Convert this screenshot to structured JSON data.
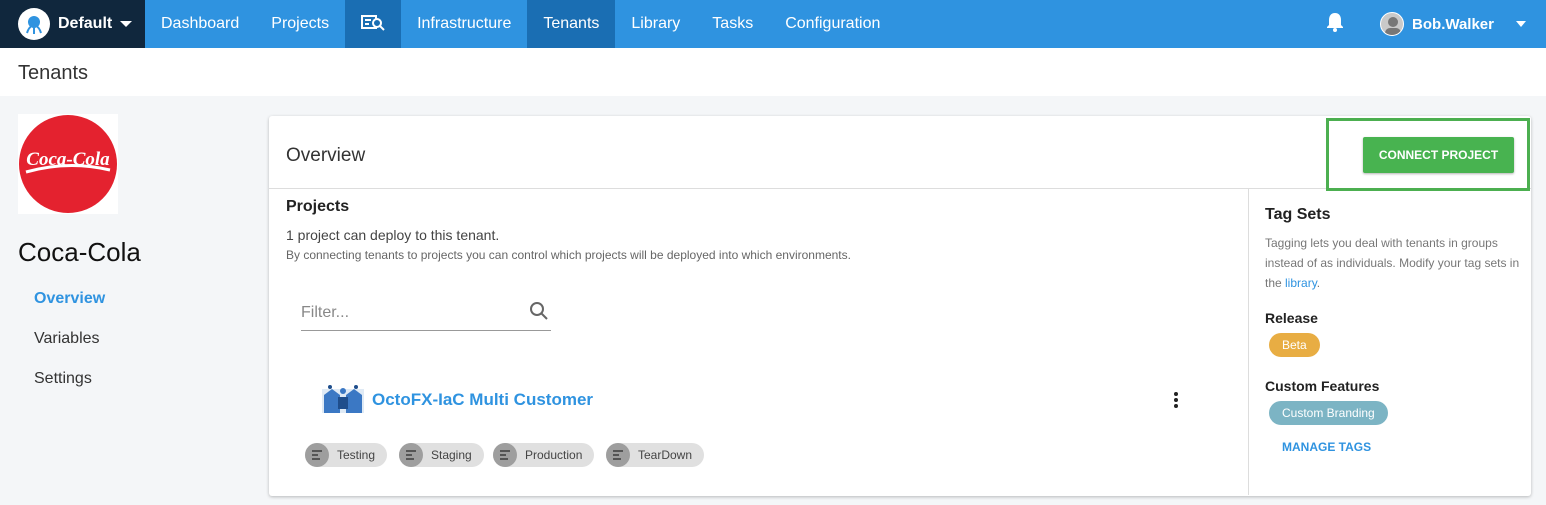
{
  "nav": {
    "space": "Default",
    "items": [
      {
        "label": "Dashboard"
      },
      {
        "label": "Projects"
      },
      {
        "label": "Infrastructure"
      },
      {
        "label": "Tenants"
      },
      {
        "label": "Library"
      },
      {
        "label": "Tasks"
      },
      {
        "label": "Configuration"
      }
    ],
    "active": "Tenants",
    "user": "Bob.Walker"
  },
  "breadcrumb": {
    "title": "Tenants"
  },
  "tenant": {
    "name": "Coca-Cola",
    "logo_text": "Coca-Cola",
    "logo_color": "#e4222f"
  },
  "sidebar": {
    "items": [
      {
        "label": "Overview",
        "active": true
      },
      {
        "label": "Variables"
      },
      {
        "label": "Settings"
      }
    ]
  },
  "overview": {
    "title": "Overview",
    "connect_button": "CONNECT PROJECT",
    "projects_heading": "Projects",
    "projects_count": "1 project can deploy to this tenant.",
    "projects_help": "By connecting tenants to projects you can control which projects will be deployed into which environments.",
    "filter_placeholder": "Filter...",
    "project": {
      "name": "OctoFX-IaC Multi Customer",
      "environments": [
        "Testing",
        "Staging",
        "Production",
        "TearDown"
      ]
    }
  },
  "tagsets": {
    "heading": "Tag Sets",
    "help_prefix": "Tagging lets you deal with tenants in groups instead of as individuals. Modify your tag sets in the ",
    "help_link": "library",
    "help_suffix": ".",
    "groups": [
      {
        "name": "Release",
        "tag": "Beta",
        "color": "#e8ad43"
      },
      {
        "name": "Custom Features",
        "tag": "Custom Branding",
        "color": "#7cb4c4"
      }
    ],
    "manage": "MANAGE TAGS"
  },
  "colors": {
    "nav": "#2f93e0",
    "nav_active": "#1a6eb3",
    "space": "#10273d",
    "primary_button": "#48b350",
    "link": "#2f93e0"
  }
}
